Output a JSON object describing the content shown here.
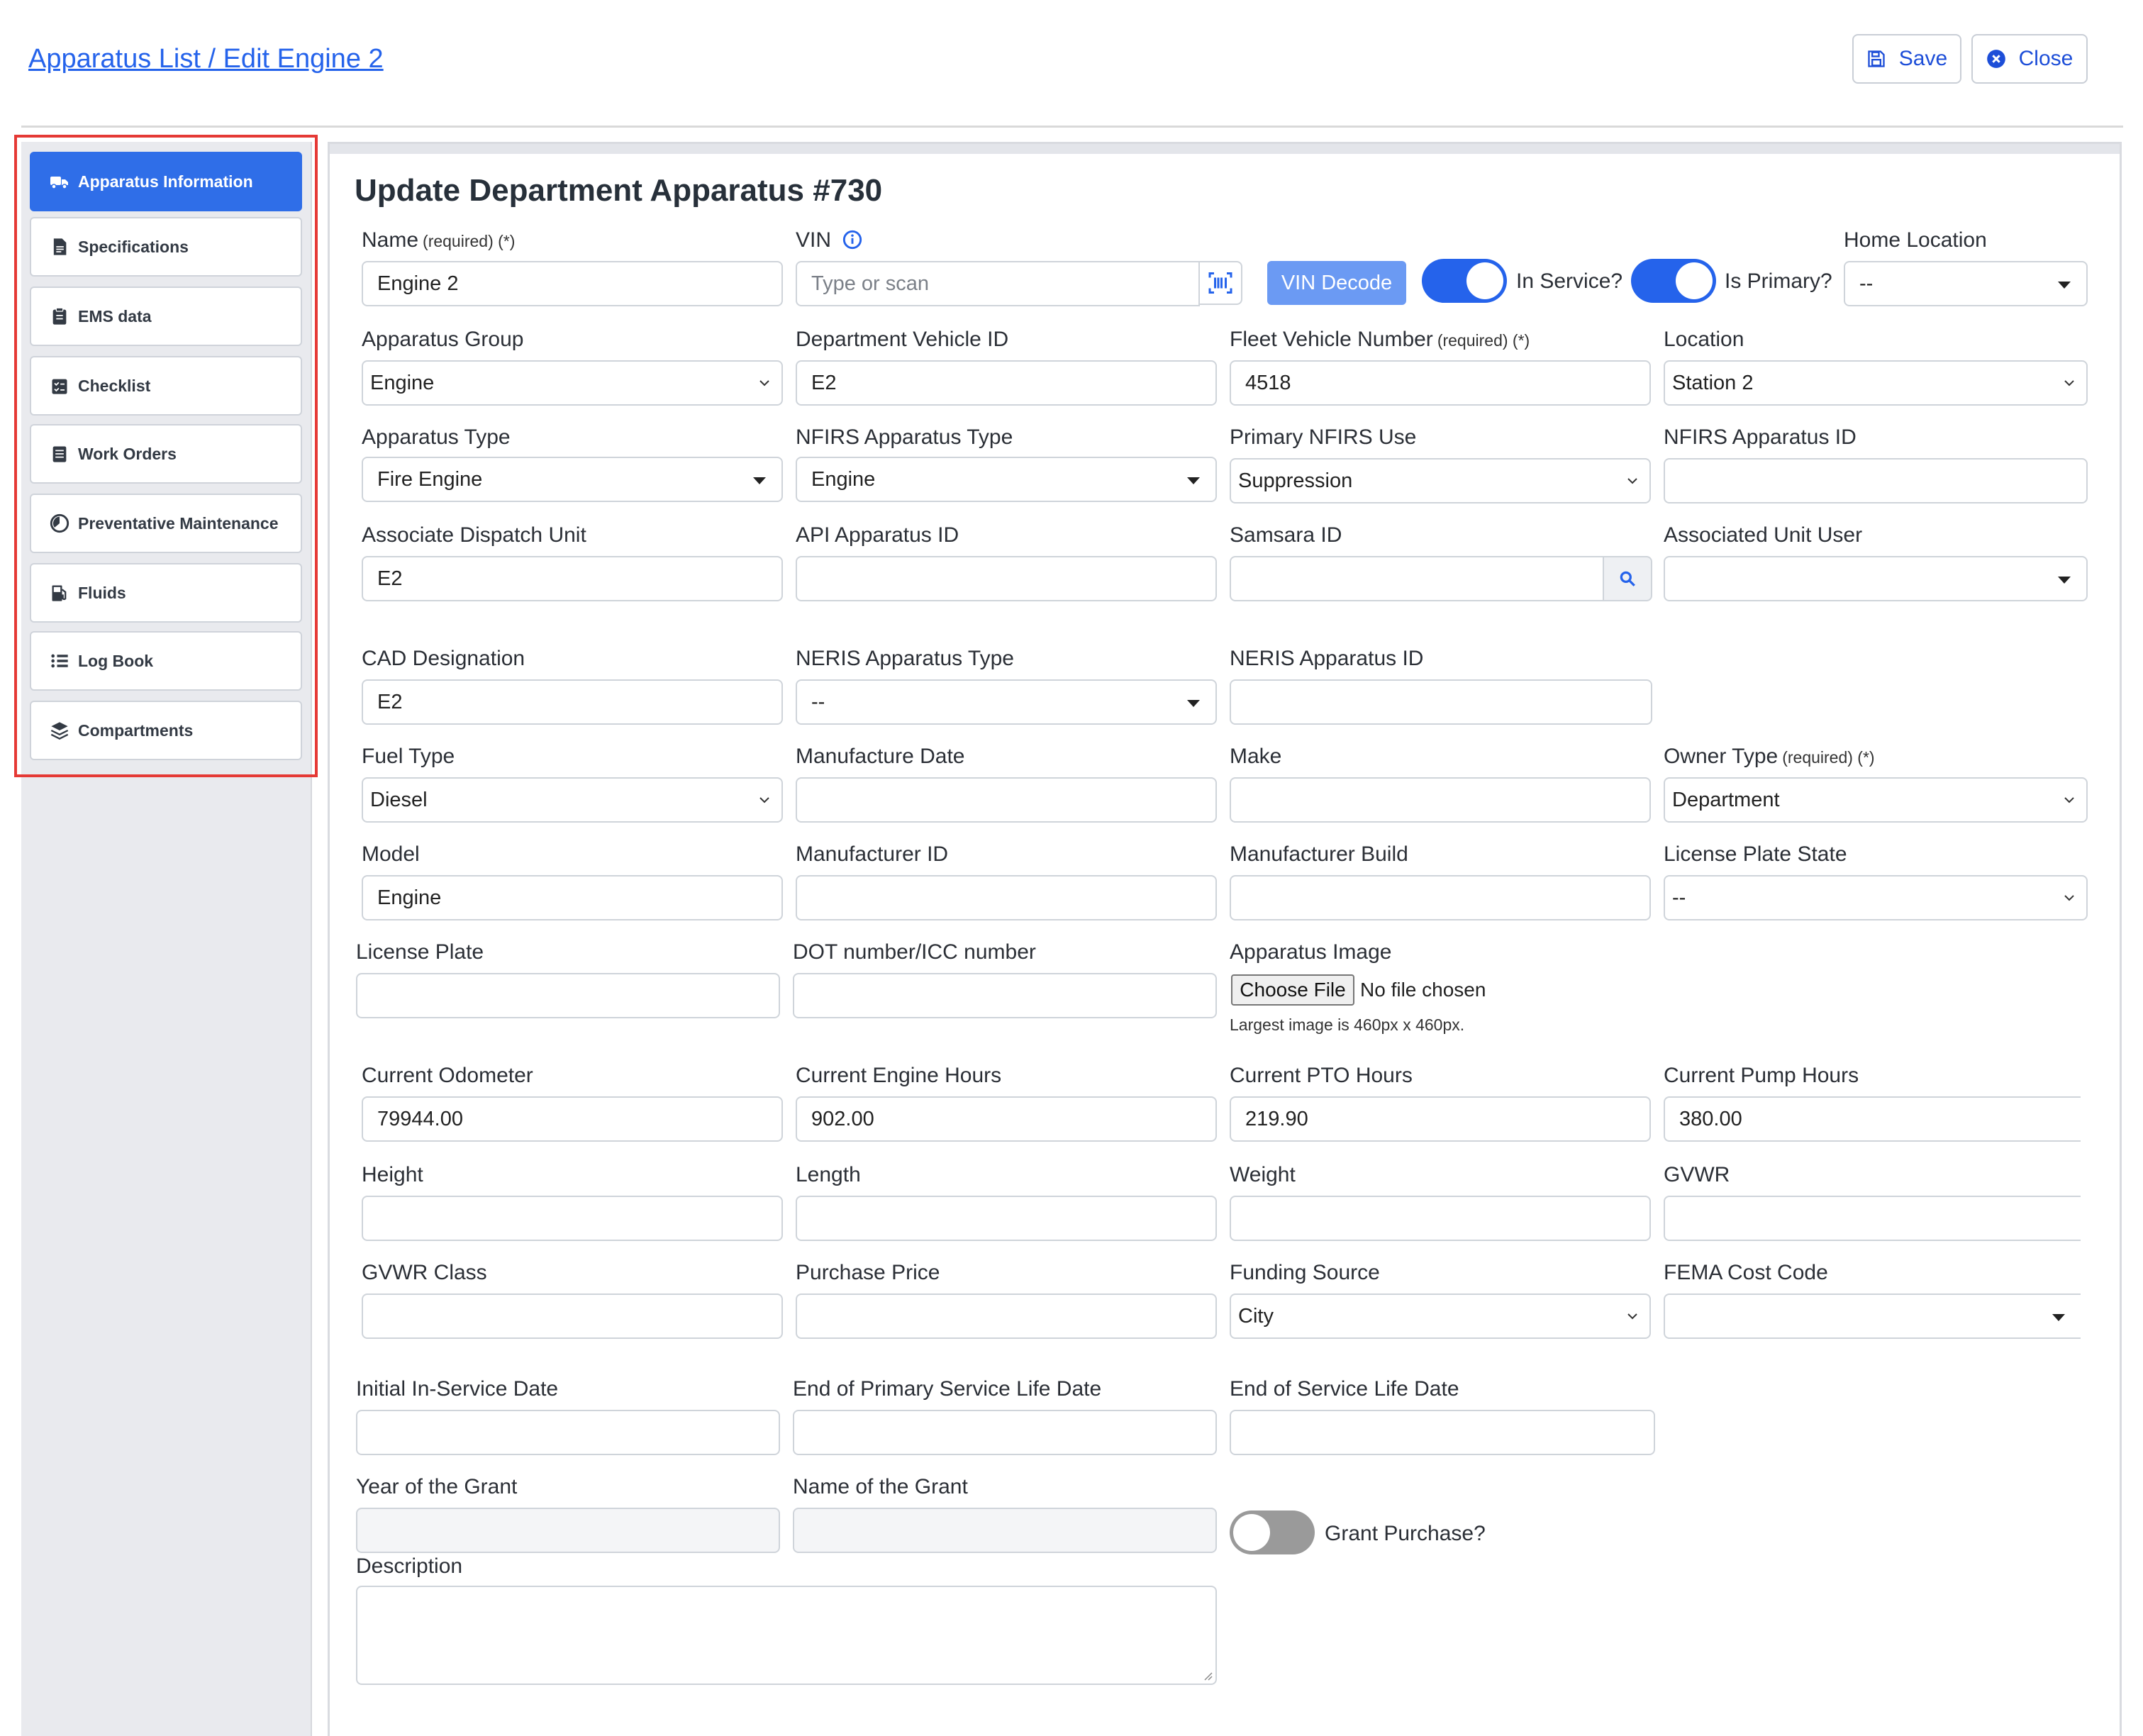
{
  "header": {
    "breadcrumb": "Apparatus List / Edit Engine 2",
    "save_label": "Save",
    "close_label": "Close"
  },
  "sidebar": {
    "items": [
      {
        "label": "Apparatus Information",
        "icon": "truck-icon",
        "active": true
      },
      {
        "label": "Specifications",
        "icon": "document-icon"
      },
      {
        "label": "EMS data",
        "icon": "clipboard-icon"
      },
      {
        "label": "Checklist",
        "icon": "checklist-icon"
      },
      {
        "label": "Work Orders",
        "icon": "list-doc-icon"
      },
      {
        "label": "Preventative Maintenance",
        "icon": "gauge-icon"
      },
      {
        "label": "Fluids",
        "icon": "fuel-pump-icon"
      },
      {
        "label": "Log Book",
        "icon": "list-icon"
      },
      {
        "label": "Compartments",
        "icon": "layers-icon"
      }
    ]
  },
  "form": {
    "title": "Update Department Apparatus #730",
    "required_marker": "(required) (*)",
    "fields": {
      "name": {
        "label": "Name",
        "value": "Engine 2"
      },
      "vin": {
        "label": "VIN",
        "placeholder": "Type or scan"
      },
      "vin_decode": "VIN Decode",
      "in_service": {
        "label": "In Service?",
        "on": true
      },
      "is_primary": {
        "label": "Is Primary?",
        "on": true
      },
      "home_location": {
        "label": "Home Location",
        "value": "--"
      },
      "apparatus_group": {
        "label": "Apparatus Group",
        "value": "Engine"
      },
      "department_vehicle_id": {
        "label": "Department Vehicle ID",
        "value": "E2"
      },
      "fleet_vehicle_number": {
        "label": "Fleet Vehicle Number",
        "value": "4518"
      },
      "location": {
        "label": "Location",
        "value": "Station 2"
      },
      "apparatus_type": {
        "label": "Apparatus Type",
        "value": "Fire Engine"
      },
      "nfirs_apparatus_type": {
        "label": "NFIRS Apparatus Type",
        "value": "Engine"
      },
      "primary_nfirs_use": {
        "label": "Primary NFIRS Use",
        "value": "Suppression"
      },
      "nfirs_apparatus_id": {
        "label": "NFIRS Apparatus ID",
        "value": ""
      },
      "associate_dispatch_unit": {
        "label": "Associate Dispatch Unit",
        "value": "E2"
      },
      "api_apparatus_id": {
        "label": "API Apparatus ID",
        "value": ""
      },
      "samsara_id": {
        "label": "Samsara ID",
        "value": ""
      },
      "associated_unit_user": {
        "label": "Associated Unit User",
        "value": ""
      },
      "cad_designation": {
        "label": "CAD Designation",
        "value": "E2"
      },
      "neris_apparatus_type": {
        "label": "NERIS Apparatus Type",
        "value": "--"
      },
      "neris_apparatus_id": {
        "label": "NERIS Apparatus ID",
        "value": ""
      },
      "fuel_type": {
        "label": "Fuel Type",
        "value": "Diesel"
      },
      "manufacture_date": {
        "label": "Manufacture Date",
        "value": ""
      },
      "make": {
        "label": "Make",
        "value": ""
      },
      "owner_type": {
        "label": "Owner Type",
        "value": "Department"
      },
      "model": {
        "label": "Model",
        "value": "Engine"
      },
      "manufacturer_id": {
        "label": "Manufacturer ID",
        "value": ""
      },
      "manufacturer_build": {
        "label": "Manufacturer Build",
        "value": ""
      },
      "license_plate_state": {
        "label": "License Plate State",
        "value": "--"
      },
      "license_plate": {
        "label": "License Plate",
        "value": ""
      },
      "dot_number": {
        "label": "DOT number/ICC number",
        "value": ""
      },
      "apparatus_image": {
        "label": "Apparatus Image",
        "button": "Choose File",
        "status": "No file chosen",
        "hint": "Largest image is 460px x 460px."
      },
      "current_odometer": {
        "label": "Current Odometer",
        "value": "79944.00"
      },
      "current_engine_hours": {
        "label": "Current Engine Hours",
        "value": "902.00"
      },
      "current_pto_hours": {
        "label": "Current PTO Hours",
        "value": "219.90"
      },
      "current_pump_hours": {
        "label": "Current Pump Hours",
        "value": "380.00"
      },
      "height": {
        "label": "Height",
        "value": ""
      },
      "length": {
        "label": "Length",
        "value": ""
      },
      "weight": {
        "label": "Weight",
        "value": ""
      },
      "gvwr": {
        "label": "GVWR",
        "value": ""
      },
      "gvwr_class": {
        "label": "GVWR Class",
        "value": ""
      },
      "purchase_price": {
        "label": "Purchase Price",
        "value": ""
      },
      "funding_source": {
        "label": "Funding Source",
        "value": "City"
      },
      "fema_cost_code": {
        "label": "FEMA Cost Code",
        "value": ""
      },
      "initial_in_service_date": {
        "label": "Initial In-Service Date",
        "value": ""
      },
      "end_primary_service": {
        "label": "End of Primary Service Life Date",
        "value": ""
      },
      "end_service": {
        "label": "End of Service Life Date",
        "value": ""
      },
      "year_of_grant": {
        "label": "Year of the Grant",
        "value": ""
      },
      "name_of_grant": {
        "label": "Name of the Grant",
        "value": ""
      },
      "grant_purchase": {
        "label": "Grant Purchase?",
        "on": false
      },
      "description": {
        "label": "Description",
        "value": ""
      }
    }
  },
  "colors": {
    "accent": "#2563eb",
    "highlight_border": "#e53935",
    "vin_decode_bg": "#6b9af3"
  }
}
